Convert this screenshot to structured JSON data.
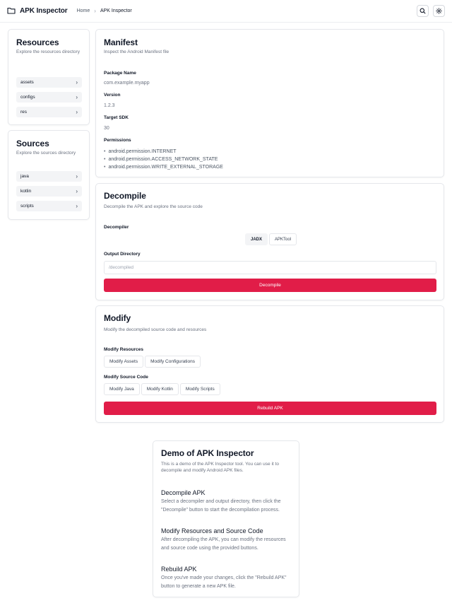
{
  "header": {
    "app_title": "APK Inspector",
    "breadcrumb": [
      "Home",
      "APK Inspector"
    ],
    "search_icon": "search-icon",
    "settings_icon": "settings-icon"
  },
  "resources": {
    "title": "Resources",
    "subtitle": "Explore the resources directory",
    "items": [
      {
        "label": "assets"
      },
      {
        "label": "configs"
      },
      {
        "label": "res"
      }
    ]
  },
  "sources": {
    "title": "Sources",
    "subtitle": "Explore the sources directory",
    "items": [
      {
        "label": "java"
      },
      {
        "label": "kotlin"
      },
      {
        "label": "scripts"
      }
    ]
  },
  "manifest": {
    "title": "Manifest",
    "subtitle": "Inspect the Android Manifest file",
    "package_label": "Package Name",
    "package_value": "com.example.myapp",
    "version_label": "Version",
    "version_value": "1.2.3",
    "sdk_label": "Target SDK",
    "sdk_value": "30",
    "permissions_label": "Permissions",
    "permissions": [
      "android.permission.INTERNET",
      "android.permission.ACCESS_NETWORK_STATE",
      "android.permission.WRITE_EXTERNAL_STORAGE"
    ]
  },
  "decompile": {
    "title": "Decompile",
    "subtitle": "Decompile the APK and explore the source code",
    "decompiler_label": "Decompiler",
    "options": [
      "JADX",
      "APKTool"
    ],
    "selected": "JADX",
    "output_label": "Output Directory",
    "output_placeholder": "/decompiled",
    "button": "Decompile"
  },
  "modify": {
    "title": "Modify",
    "subtitle": "Modify the decompiled source code and resources",
    "resources_label": "Modify Resources",
    "resources_buttons": [
      "Modify Assets",
      "Modify Configurations"
    ],
    "source_label": "Modify Source Code",
    "source_buttons": [
      "Modify Java",
      "Modify Kotlin",
      "Modify Scripts"
    ],
    "rebuild_button": "Rebuild APK"
  },
  "demo": {
    "title": "Demo of APK Inspector",
    "subtitle": "This is a demo of the APK Inspector tool. You can use it to decompile and modify Android APK files.",
    "sections": [
      {
        "heading": "Decompile APK",
        "body": "Select a decompiler and output directory, then click the \"Decompile\" button to start the decompilation process."
      },
      {
        "heading": "Modify Resources and Source Code",
        "body": "After decompiling the APK, you can modify the resources and source code using the provided buttons."
      },
      {
        "heading": "Rebuild APK",
        "body": "Once you've made your changes, click the \"Rebuild APK\" button to generate a new APK file."
      }
    ]
  },
  "colors": {
    "accent": "#e11d48",
    "border": "#e5e7eb",
    "muted_text": "#6b7280",
    "item_bg": "#f3f4f6"
  }
}
